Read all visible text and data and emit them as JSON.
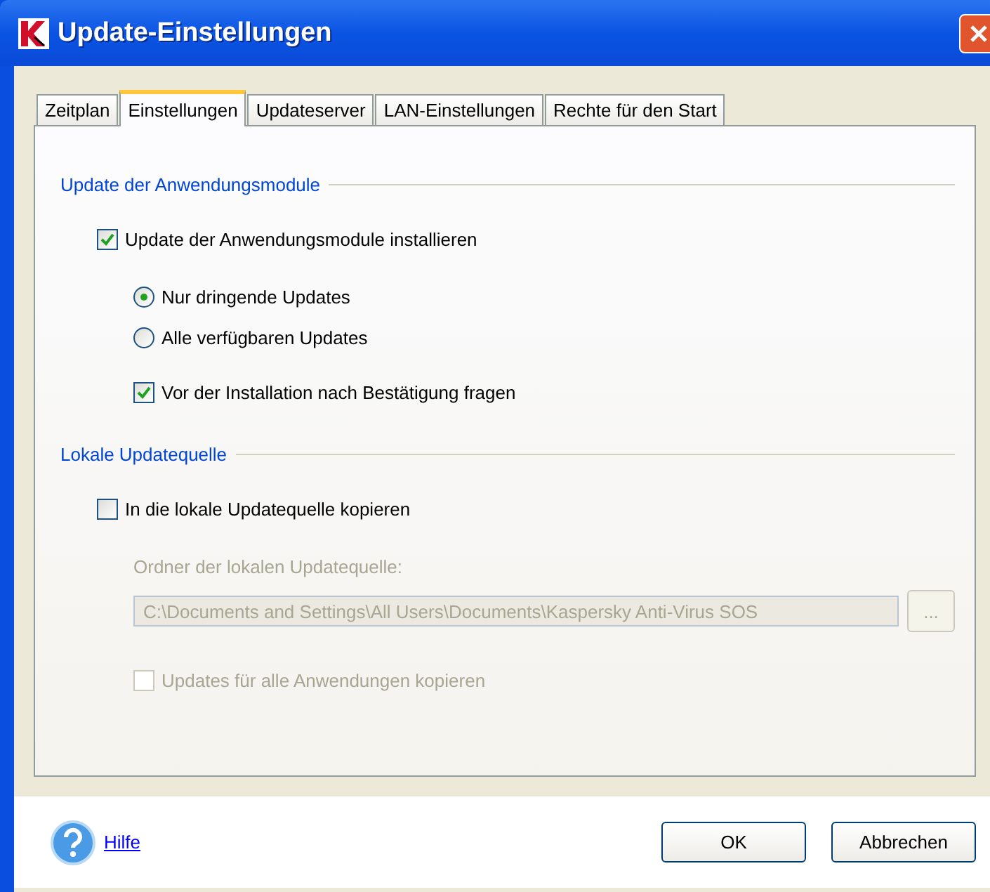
{
  "window": {
    "title": "Update-Einstellungen"
  },
  "tabs": [
    {
      "label": "Zeitplan",
      "selected": false
    },
    {
      "label": "Einstellungen",
      "selected": true
    },
    {
      "label": "Updateserver",
      "selected": false
    },
    {
      "label": "LAN-Einstellungen",
      "selected": false
    },
    {
      "label": "Rechte für den Start",
      "selected": false
    }
  ],
  "sections": [
    {
      "title": "Update der Anwendungsmodule",
      "items": [
        {
          "kind": "checkbox",
          "label": "Update der Anwendungsmodule installieren",
          "checked": true,
          "disabled": false,
          "children": [
            {
              "kind": "radio",
              "label": "Nur dringende Updates",
              "selected": true,
              "disabled": false
            },
            {
              "kind": "radio",
              "label": "Alle verfügbaren Updates",
              "selected": false,
              "disabled": false
            },
            {
              "kind": "checkbox",
              "label": "Vor der Installation nach Bestätigung fragen",
              "checked": true,
              "disabled": false
            }
          ]
        }
      ]
    },
    {
      "title": "Lokale Updatequelle",
      "items": [
        {
          "kind": "checkbox",
          "label": "In die lokale Updatequelle kopieren",
          "checked": false,
          "disabled": false,
          "children": [
            {
              "kind": "label",
              "label": "Ordner der lokalen Updatequelle:",
              "disabled": true
            },
            {
              "kind": "path",
              "value": "C:\\Documents and Settings\\All Users\\Documents\\Kaspersky Anti-Virus SOS",
              "browse": "...",
              "disabled": true
            },
            {
              "kind": "checkbox",
              "label": "Updates für alle Anwendungen kopieren",
              "checked": false,
              "disabled": true
            }
          ]
        }
      ]
    }
  ],
  "footer": {
    "help": "Hilfe",
    "buttons": [
      "OK",
      "Abbrechen"
    ]
  }
}
